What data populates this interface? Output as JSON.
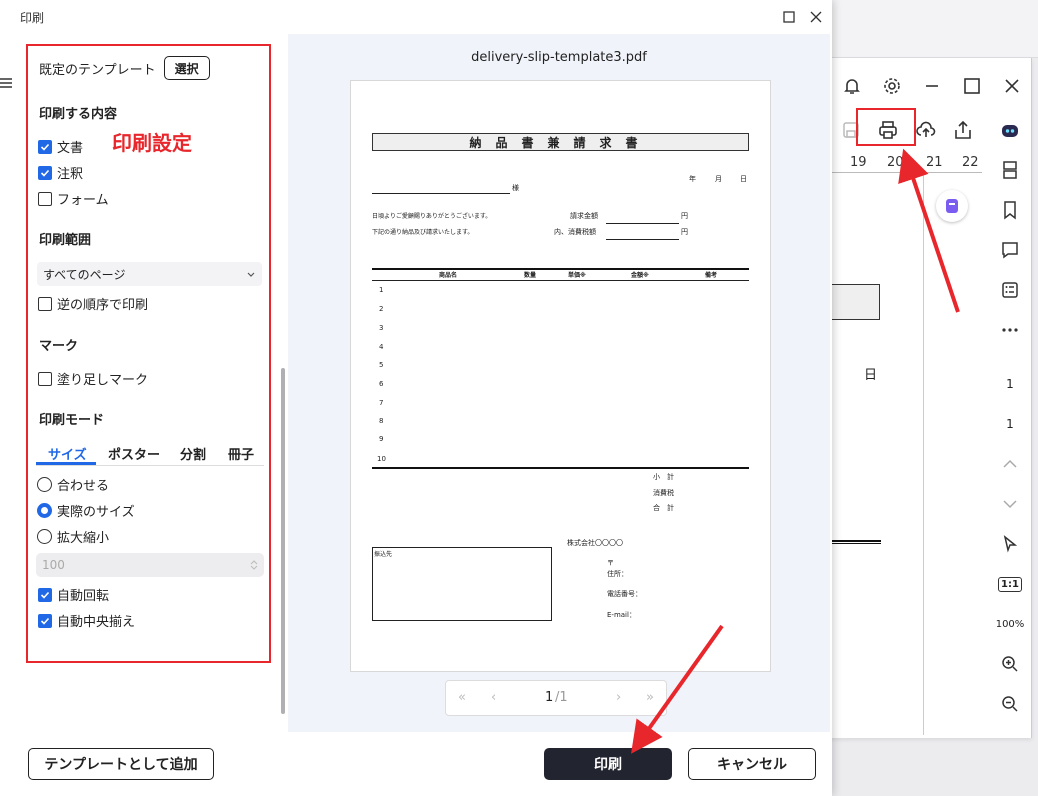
{
  "app": {
    "ruler": [
      "19",
      "20",
      "21",
      "22"
    ],
    "bg_doc_day": "日",
    "sidebar_page_current": "1",
    "sidebar_page_total": "1",
    "sidebar_fit": "1:1",
    "sidebar_zoom": "100%"
  },
  "dialog": {
    "title": "印刷",
    "template_label": "既定のテンプレート",
    "select_button": "選択",
    "annotation": "印刷設定",
    "content": {
      "heading": "印刷する内容",
      "items": [
        {
          "label": "文書",
          "checked": true
        },
        {
          "label": "注釈",
          "checked": true
        },
        {
          "label": "フォーム",
          "checked": false
        }
      ]
    },
    "range": {
      "heading": "印刷範囲",
      "selected": "すべてのページ",
      "reverse_label": "逆の順序で印刷"
    },
    "marks": {
      "heading": "マーク",
      "bleed_label": "塗り足しマーク"
    },
    "mode": {
      "heading": "印刷モード",
      "tabs": [
        "サイズ",
        "ポスター",
        "分割",
        "冊子"
      ],
      "active_tab": "サイズ",
      "options": [
        {
          "label": "合わせる",
          "selected": false
        },
        {
          "label": "実際のサイズ",
          "selected": true
        },
        {
          "label": "拡大縮小",
          "selected": false
        }
      ],
      "scale_value": "100",
      "auto_rotate": "自動回転",
      "auto_center": "自動中央揃え"
    },
    "add_template_button": "テンプレートとして追加",
    "print_button": "印刷",
    "cancel_button": "キャンセル"
  },
  "preview": {
    "filename": "delivery-slip-template3.pdf",
    "page_current": "1",
    "page_total": "/1",
    "document": {
      "title": "納品書兼請求書",
      "date_year": "年",
      "date_month": "月",
      "date_day": "日",
      "honorific": "様",
      "greeting1": "日頃よりご愛顧賜りありがとうございます。",
      "greeting2": "下記の通り納品及び請求いたします。",
      "amount_label": "請求金額",
      "tax_label": "内、消費税額",
      "yen": "円",
      "columns": [
        "商品名",
        "数量",
        "単価※",
        "金額※",
        "備考"
      ],
      "rows": [
        "1",
        "2",
        "3",
        "4",
        "5",
        "6",
        "7",
        "8",
        "9",
        "10"
      ],
      "subtotal": "小　計",
      "tax": "消費税",
      "total": "合　計",
      "company": "株式会社〇〇〇〇",
      "bank_label": "振込先",
      "postal": "〒",
      "address": "住所：",
      "phone": "電話番号：",
      "email": "E-mail："
    }
  }
}
